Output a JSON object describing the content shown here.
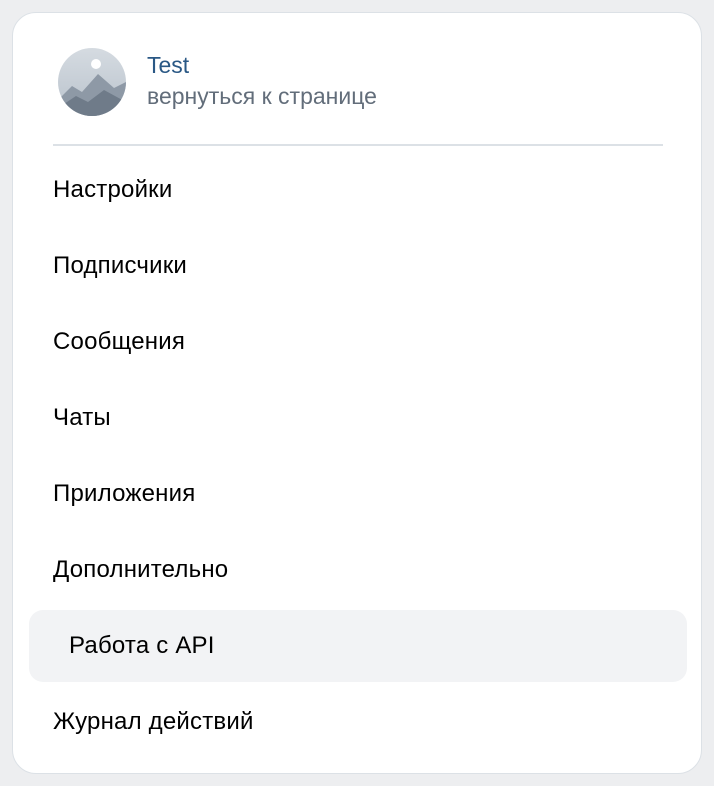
{
  "profile": {
    "name": "Test",
    "back_link": "вернуться к странице"
  },
  "menu": {
    "items": [
      {
        "label": "Настройки"
      },
      {
        "label": "Подписчики"
      },
      {
        "label": "Сообщения"
      },
      {
        "label": "Чаты"
      },
      {
        "label": "Приложения"
      },
      {
        "label": "Дополнительно"
      },
      {
        "label": "Работа с API",
        "active": true
      },
      {
        "label": "Журнал действий"
      }
    ]
  },
  "colors": {
    "link": "#2a5885",
    "secondary_text": "#626d7a",
    "active_bg": "#f2f3f5",
    "divider": "#dce1e6"
  },
  "icons": {
    "avatar": "mountain-placeholder-avatar"
  }
}
